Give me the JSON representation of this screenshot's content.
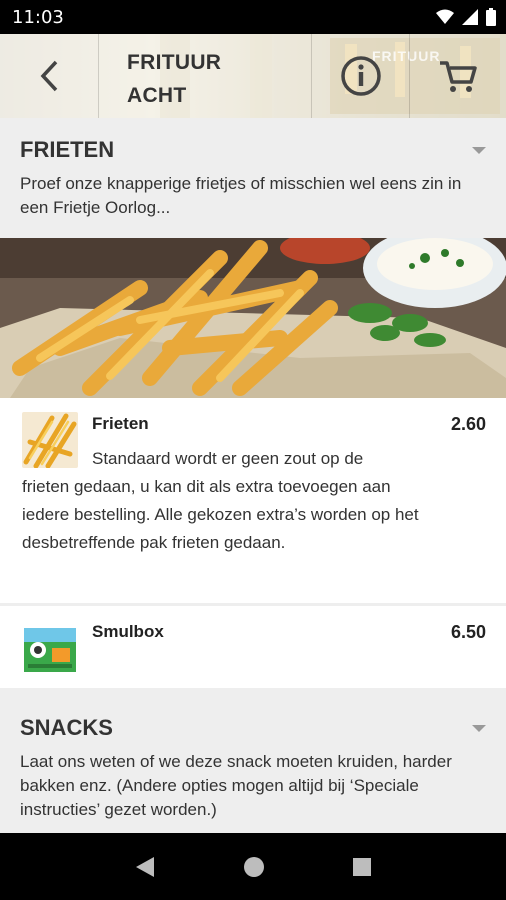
{
  "status_bar": {
    "time": "11:03"
  },
  "header": {
    "title_line1": "FRITUUR",
    "title_line2": "ACHT",
    "brand_text": "FRITUUR"
  },
  "sections": [
    {
      "title": "FRIETEN",
      "description": "Proef onze knapperige frietjes of misschien wel eens zin in een Frietje Oorlog..."
    },
    {
      "title": "SNACKS",
      "description": "Laat ons weten of we deze snack moeten kruiden, harder bakken enz. (Andere opties mogen altijd bij ‘Speciale instructies’ gezet worden.)"
    }
  ],
  "items": [
    {
      "name": "Frieten",
      "price": "2.60",
      "description_line1": "Standaard wordt er geen zout op de",
      "description_rest": "frieten gedaan, u kan dit als extra toevoegen aan iedere bestelling. Alle gekozen extra’s worden op het desbetreffende pak frieten gedaan."
    },
    {
      "name": "Smulbox",
      "price": "6.50"
    }
  ],
  "icons": {
    "back": "back-arrow-icon",
    "info": "info-icon",
    "cart": "cart-icon",
    "dropdown": "dropdown-arrow-icon"
  },
  "colors": {
    "text": "#333333",
    "background": "#eeeeee",
    "card": "#ffffff"
  }
}
